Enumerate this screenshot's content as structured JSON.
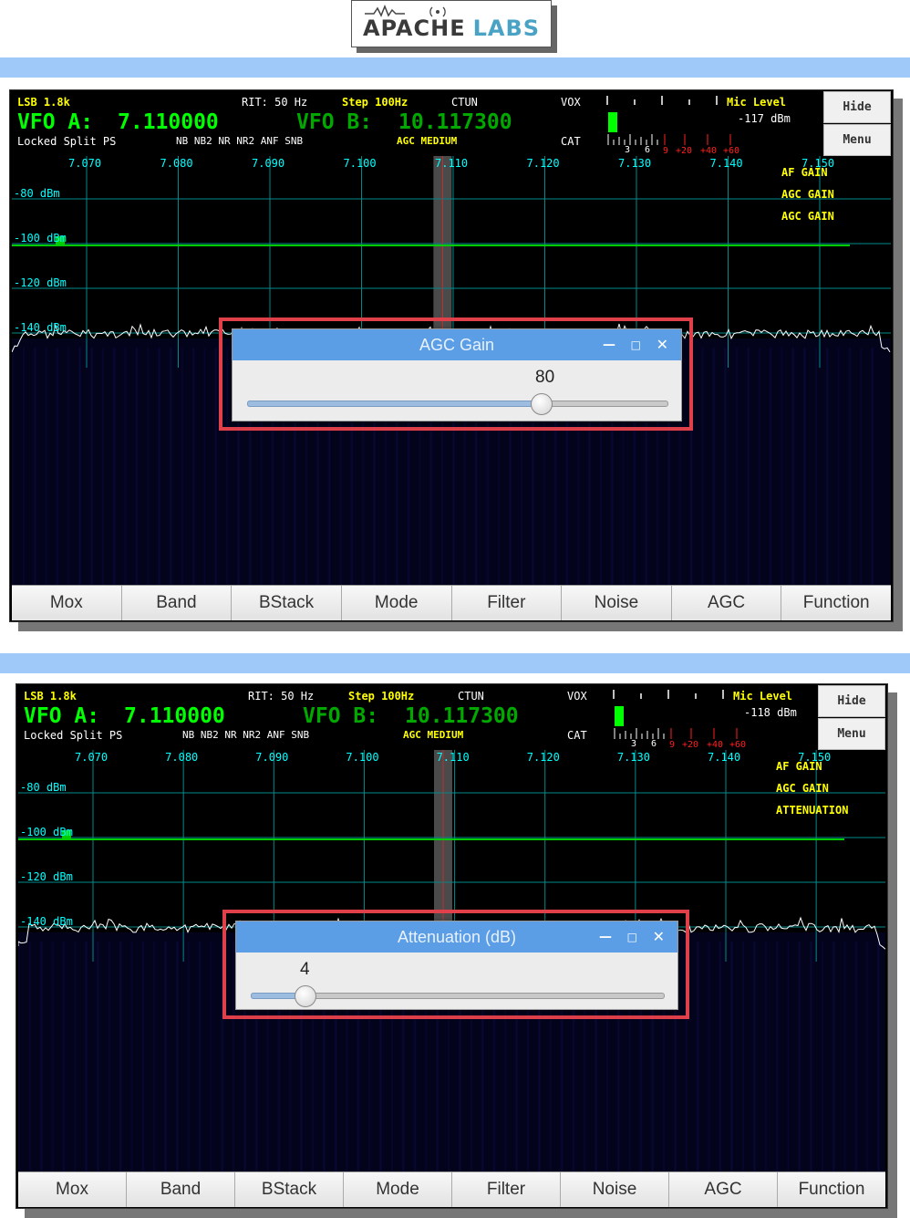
{
  "logo": {
    "brand": "APACHE",
    "brand2": "LABS"
  },
  "panels": [
    {
      "mode": "LSB 1.8k",
      "rit": "RIT: 50 Hz",
      "step": "Step 100Hz",
      "ctun": "CTUN",
      "vox": "VOX",
      "cat": "CAT",
      "vfo_a_label": "VFO A:",
      "vfo_a_freq": "7.110000",
      "vfo_b_label": "VFO B:",
      "vfo_b_freq": "10.117300",
      "status_line": "Locked Split  PS",
      "nr_line": "NB NB2 NR  NR2 ANF SNB",
      "agc": "AGC MEDIUM",
      "mic_level": "Mic Level",
      "dbm": "-117 dBm",
      "meter_scale": [
        "3",
        "6"
      ],
      "meter_red": [
        "9",
        "+20",
        "+40",
        "+60"
      ],
      "hide": "Hide",
      "menu": "Menu",
      "freq_labels": [
        "7.070",
        "7.080",
        "7.090",
        "7.100",
        "7.110",
        "7.120",
        "7.130",
        "7.140",
        "7.150"
      ],
      "db_labels": [
        "-80 dBm",
        "-100 dBm",
        "-120 dBm",
        "-140 dBm"
      ],
      "overlay_labels": [
        "AF GAIN",
        "AGC GAIN",
        "AGC GAIN"
      ],
      "dialog": {
        "title": "AGC Gain",
        "value": "80",
        "slider_fraction": 0.7
      },
      "buttons": [
        "Mox",
        "Band",
        "BStack",
        "Mode",
        "Filter",
        "Noise",
        "AGC",
        "Function"
      ]
    },
    {
      "mode": "LSB 1.8k",
      "rit": "RIT: 50 Hz",
      "step": "Step 100Hz",
      "ctun": "CTUN",
      "vox": "VOX",
      "cat": "CAT",
      "vfo_a_label": "VFO A:",
      "vfo_a_freq": "7.110000",
      "vfo_b_label": "VFO B:",
      "vfo_b_freq": "10.117300",
      "status_line": "Locked Split  PS",
      "nr_line": "NB NB2 NR  NR2 ANF SNB",
      "agc": "AGC MEDIUM",
      "mic_level": "Mic Level",
      "dbm": "-118 dBm",
      "meter_scale": [
        "3",
        "6"
      ],
      "meter_red": [
        "9",
        "+20",
        "+40",
        "+60"
      ],
      "hide": "Hide",
      "menu": "Menu",
      "freq_labels": [
        "7.070",
        "7.080",
        "7.090",
        "7.100",
        "7.110",
        "7.120",
        "7.130",
        "7.140",
        "7.150"
      ],
      "db_labels": [
        "-80 dBm",
        "-100 dBm",
        "-120 dBm",
        "-140 dBm"
      ],
      "overlay_labels": [
        "AF GAIN",
        "AGC GAIN",
        "ATTENUATION"
      ],
      "dialog": {
        "title": "Attenuation (dB)",
        "value": "4",
        "slider_fraction": 0.13
      },
      "buttons": [
        "Mox",
        "Band",
        "BStack",
        "Mode",
        "Filter",
        "Noise",
        "AGC",
        "Function"
      ]
    }
  ],
  "colors": {
    "vfo_green": "#00ff00",
    "label_yellow": "#ffff00",
    "grid_cyan": "#008b8b",
    "filter_line": "#00cc00",
    "dialog_title": "#5b9ee6",
    "highlight_red": "#e0404a",
    "separator_blue": "#9ec9f8"
  },
  "icons": {
    "minimize": "minimize-icon",
    "maximize": "maximize-icon",
    "close": "close-icon"
  }
}
